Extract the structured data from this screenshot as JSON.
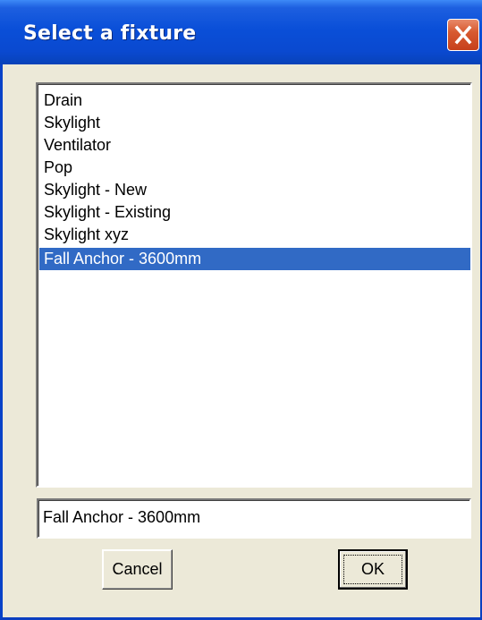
{
  "dialog": {
    "title": "Select a fixture"
  },
  "fixture_list": {
    "items": [
      "Drain",
      "Skylight",
      "Ventilator",
      "Pop",
      "Skylight - New",
      "Skylight - Existing",
      "Skylight xyz",
      "Fall Anchor - 3600mm"
    ],
    "selected_item": "Fall Anchor - 3600mm"
  },
  "selected_field": {
    "value": "Fall Anchor - 3600mm"
  },
  "buttons": {
    "cancel_label": "Cancel",
    "ok_label": "OK"
  },
  "icons": {
    "close": "close-icon"
  },
  "colors": {
    "title_bar": "#0a4fd8",
    "selection": "#316ac5",
    "close_button": "#d85a30",
    "dialog_background": "#ece9d8"
  }
}
